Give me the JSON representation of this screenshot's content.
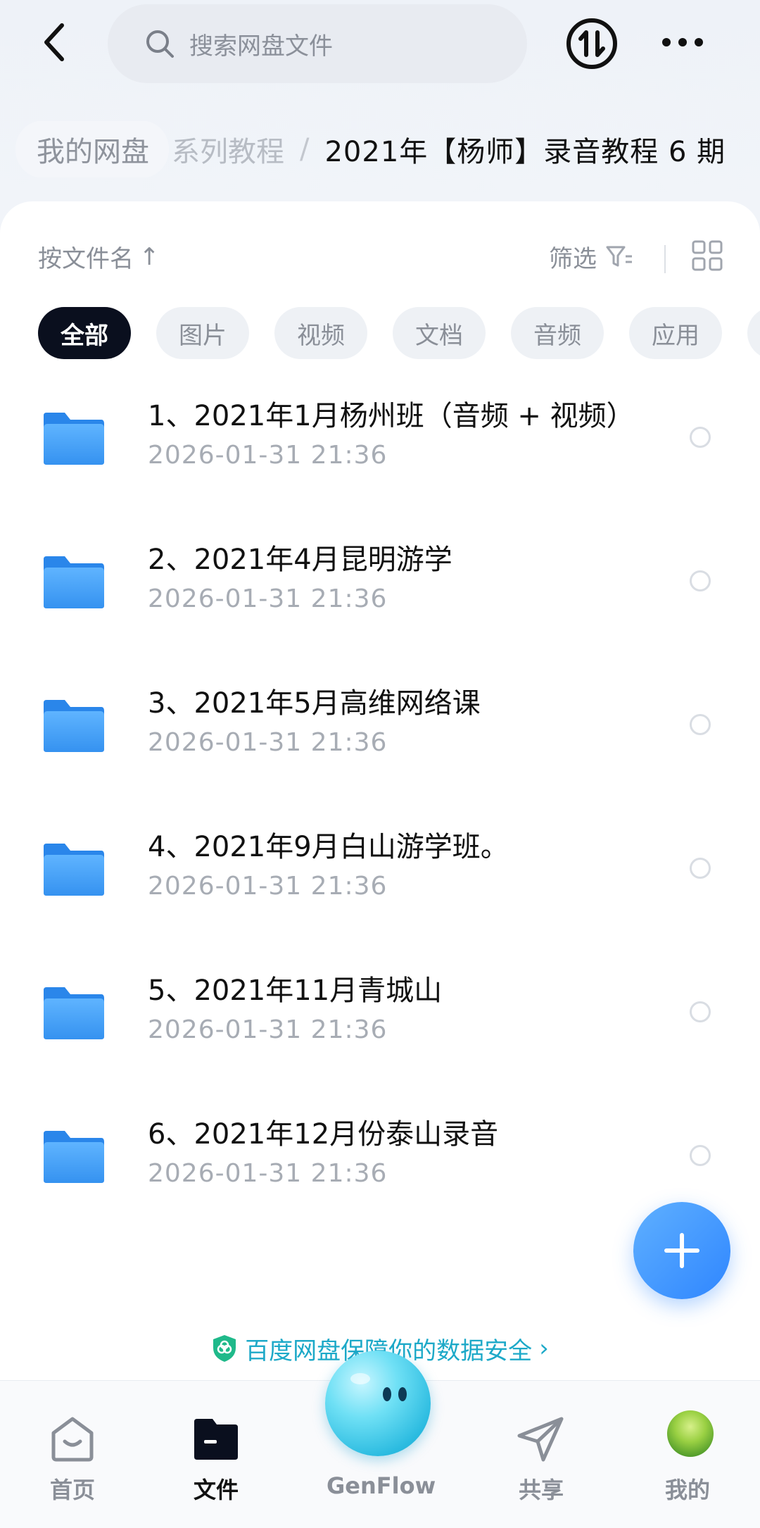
{
  "search": {
    "placeholder": "搜索网盘文件"
  },
  "breadcrumb": {
    "root": "我的网盘",
    "mid": "系列教程",
    "sep": "/",
    "current": "2021年【杨师】录音教程 6 期"
  },
  "sort": {
    "label": "按文件名",
    "arrow": "↑"
  },
  "filter": {
    "label": "筛选"
  },
  "chips": [
    "全部",
    "图片",
    "视频",
    "文档",
    "音频",
    "应用"
  ],
  "files": [
    {
      "name": "1、2021年1月杨州班（音频 + 视频）",
      "date": "2026-01-31  21:36"
    },
    {
      "name": "2、2021年4月昆明游学",
      "date": "2026-01-31  21:36"
    },
    {
      "name": "3、2021年5月高维网络课",
      "date": "2026-01-31  21:36"
    },
    {
      "name": "4、2021年9月白山游学班。",
      "date": "2026-01-31  21:36"
    },
    {
      "name": "5、2021年11月青城山",
      "date": "2026-01-31  21:36"
    },
    {
      "name": "6、2021年12月份泰山录音",
      "date": "2026-01-31  21:36"
    }
  ],
  "security_banner": {
    "text": "百度网盘保障你的数据安全",
    "arrow": "›"
  },
  "nav": {
    "home": "首页",
    "files": "文件",
    "genflow": "GenFlow",
    "share": "共享",
    "mine": "我的"
  },
  "colors": {
    "accent": "#2f86ff",
    "folder": "#4aa4f5",
    "security_text": "#1da9c8",
    "active_chip": "#0a0f1e"
  },
  "icons": [
    "back-arrow-icon",
    "search-icon",
    "sync-icon",
    "more-icon",
    "sort-arrow-icon",
    "filter-icon",
    "grid-view-icon",
    "folder-icon",
    "plus-icon",
    "shield-icon",
    "home-icon",
    "files-icon",
    "share-icon"
  ]
}
